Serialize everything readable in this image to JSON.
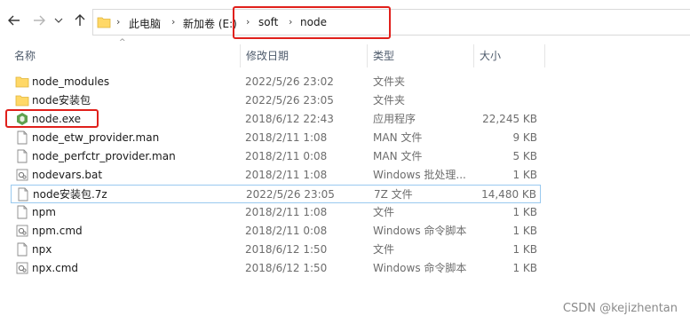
{
  "address_bar": {
    "crumbs": [
      "此电脑",
      "新加卷 (E:)",
      "soft",
      "node"
    ]
  },
  "columns": {
    "name": "名称",
    "date": "修改日期",
    "type": "类型",
    "size": "大小"
  },
  "files": [
    {
      "name": "node_modules",
      "date": "2022/5/26 23:02",
      "type": "文件夹",
      "size": "",
      "icon": "folder-icon"
    },
    {
      "name": "node安装包",
      "date": "2022/5/26 23:05",
      "type": "文件夹",
      "size": "",
      "icon": "folder-icon"
    },
    {
      "name": "node.exe",
      "date": "2018/6/12 22:43",
      "type": "应用程序",
      "size": "22,245 KB",
      "icon": "node-app-icon"
    },
    {
      "name": "node_etw_provider.man",
      "date": "2018/2/11 1:08",
      "type": "MAN 文件",
      "size": "9 KB",
      "icon": "file-icon"
    },
    {
      "name": "node_perfctr_provider.man",
      "date": "2018/2/11 0:08",
      "type": "MAN 文件",
      "size": "5 KB",
      "icon": "file-icon"
    },
    {
      "name": "nodevars.bat",
      "date": "2018/2/11 1:08",
      "type": "Windows 批处理...",
      "size": "1 KB",
      "icon": "batch-file-icon"
    },
    {
      "name": "node安装包.7z",
      "date": "2022/5/26 23:05",
      "type": "7Z 文件",
      "size": "14,480 KB",
      "icon": "file-icon"
    },
    {
      "name": "npm",
      "date": "2018/2/11 1:08",
      "type": "文件",
      "size": "1 KB",
      "icon": "file-icon"
    },
    {
      "name": "npm.cmd",
      "date": "2018/2/11 0:08",
      "type": "Windows 命令脚本",
      "size": "1 KB",
      "icon": "batch-file-icon"
    },
    {
      "name": "npx",
      "date": "2018/6/12 1:50",
      "type": "文件",
      "size": "1 KB",
      "icon": "file-icon"
    },
    {
      "name": "npx.cmd",
      "date": "2018/6/12 1:50",
      "type": "Windows 命令脚本",
      "size": "1 KB",
      "icon": "batch-file-icon"
    }
  ],
  "watermark": "CSDN @kejizhentan",
  "colors": {
    "highlight": "#e0201b",
    "selection_border": "#99c9ef",
    "folder": "#ffd867",
    "node_green": "#5fa04e"
  }
}
